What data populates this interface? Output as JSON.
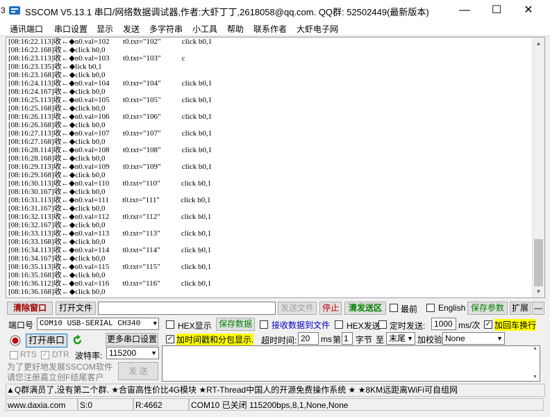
{
  "titlebar": {
    "left_num": "3",
    "title": "SSCOM V5.13.1 串口/网络数据调试器,作者:大虾丁丁,2618058@qq.com. QQ群: 52502449(最新版本)",
    "minimize": "—",
    "maximize": "☐",
    "close": "✕"
  },
  "menu": [
    "通讯端口",
    "串口设置",
    "显示",
    "发送",
    "多字符串",
    "小工具",
    "帮助",
    "联系作者",
    "大虾电子网"
  ],
  "log": {
    "lines": [
      "[08:16:22.113]收←◆n0.val=102       t0.txt=\"102\"           click b0,1",
      "[08:16:22.168]收←◆click b0,0",
      "[08:16:23.113]收←◆n0.val=103       t0.txt=\"103\"           c",
      "[08:16:23.135]收←◆lick b0,1",
      "[08:16:23.168]收←◆click b0,0",
      "[08:16:24.113]收←◆n0.val=104       t0.txt=\"104\"           click b0,1",
      "[08:16:24.167]收←◆click b0,0",
      "[08:16:25.113]收←◆n0.val=105       t0.txt=\"105\"           click b0,1",
      "[08:16:25.168]收←◆click b0,0",
      "[08:16:26.113]收←◆n0.val=106       t0.txt=\"106\"           click b0,1",
      "[08:16:26.168]收←◆click b0,0",
      "[08:16:27.113]收←◆n0.val=107       t0.txt=\"107\"           click b0,1",
      "[08:16:27.168]收←◆click b0,0",
      "[08:16:28.114]收←◆n0.val=108       t0.txt=\"108\"           click b0,1",
      "[08:16:28.168]收←◆click b0,0",
      "[08:16:29.113]收←◆n0.val=109       t0.txt=\"109\"           click b0,1",
      "[08:16:29.168]收←◆click b0,0",
      "[08:16:30.113]收←◆n0.val=110       t0.txt=\"110\"           click b0,1",
      "[08:16:30.167]收←◆click b0,0",
      "[08:16:31.113]收←◆n0.val=111       t0.txt=\"111\"           click b0,1",
      "[08:16:31.167]收←◆click b0,0",
      "[08:16:32.113]收←◆n0.val=112       t0.txt=\"112\"           click b0,1",
      "[08:16:32.167]收←◆click b0,0",
      "[08:16:33.113]收←◆n0.val=113       t0.txt=\"113\"           click b0,1",
      "[08:16:33.168]收←◆click b0,0",
      "[08:16:34.113]收←◆n0.val=114       t0.txt=\"114\"           click b0,1",
      "[08:16:34.167]收←◆click b0,0",
      "[08:16:35.113]收←◆n0.val=115       t0.txt=\"115\"           click b0,1",
      "[08:16:35.168]收←◆click b0,0",
      "[08:16:36.112]收←◆n0.val=116       t0.txt=\"116\"           click b0,1",
      "[08:16:36.168]收←◆click b0,0"
    ]
  },
  "toolbar1": {
    "clear_window": "清除窗口",
    "open_file": "打开文件",
    "send_file": "发送文件",
    "stop": "停止",
    "clear_send": "清发送区",
    "last": "最前",
    "english": "English",
    "save_params": "保存参数",
    "expand": "扩展",
    "collapse": "—"
  },
  "port": {
    "label": "端口号",
    "value": "COM10 USB-SERIAL CH340",
    "hex_display": "HEX显示",
    "save_data": "保存数据",
    "recv_to_file": "接收数据到文件",
    "hex_send": "HEX发送",
    "timed_send": "定时发送:",
    "interval": "1000",
    "interval_unit": "ms/次",
    "add_crlf": "加回车换行",
    "open_port": "打开串口",
    "more_settings": "更多串口设置",
    "timestamp": "加时间戳和分包显示.",
    "timeout_label": "超时时间:",
    "timeout": "20",
    "ms": "ms",
    "nth_label": "第",
    "nth": "1",
    "byte_label": "字节",
    "to_label": "至",
    "end": "末尾",
    "checksum_label": "加校验",
    "checksum": "None",
    "rts": "RTS",
    "dtr": "DTR",
    "baud_label": "波特率:",
    "baud": "115200",
    "hint": "为了更好地发展SSCOM软件\n请您注册嘉立创F结尾客户",
    "send": "发 送"
  },
  "adbar": "▲Q群满员了,没有第二个群. ★合宙高性价比4G模块 ★RT-Thread中国人的开源免费操作系统 ★ ★8KM远距离WiFi可自组网",
  "status": {
    "site": "www.daxia.com",
    "s": "S:0",
    "r": "R:4662",
    "port_status": "COM10 已关闭  115200bps,8,1,None,None"
  },
  "colors": {
    "accent_red": "#c00000",
    "accent_green": "#008000",
    "highlight": "#ffff00"
  }
}
